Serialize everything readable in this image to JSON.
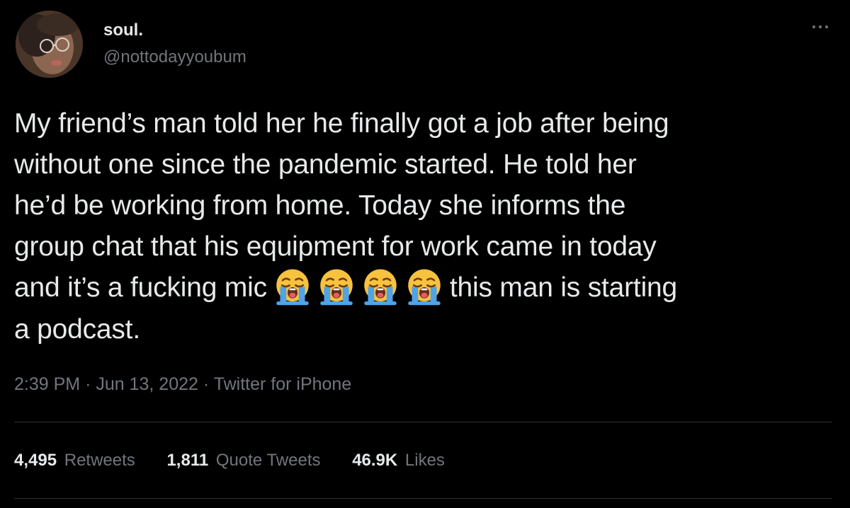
{
  "user": {
    "display_name": "soul.",
    "handle": "@nottodayyoubum"
  },
  "icons": {
    "more": "more-horizontal-icon",
    "emoji": "loudly-crying-face-emoji"
  },
  "tweet": {
    "lines": [
      "My friend’s man told her he finally got a job after being",
      "without one since the pandemic started. He told her",
      "he’d be working from home. Today she informs the",
      "group chat that his equipment for work came in today"
    ],
    "line5_before": "and it’s a fucking mic",
    "emoji_count": 4,
    "line5_after": "this man is starting",
    "line6": "a podcast."
  },
  "meta": {
    "time": "2:39 PM",
    "date": "Jun 13, 2022",
    "source": "Twitter for iPhone",
    "separator": "·"
  },
  "stats": {
    "retweets_count": "4,495",
    "retweets_label": "Retweets",
    "quotes_count": "1,811",
    "quotes_label": "Quote Tweets",
    "likes_count": "46.9K",
    "likes_label": "Likes"
  },
  "colors": {
    "background": "#000000",
    "primary_text": "#e7e9ea",
    "secondary_text": "#71767b",
    "divider": "#2f3336"
  }
}
